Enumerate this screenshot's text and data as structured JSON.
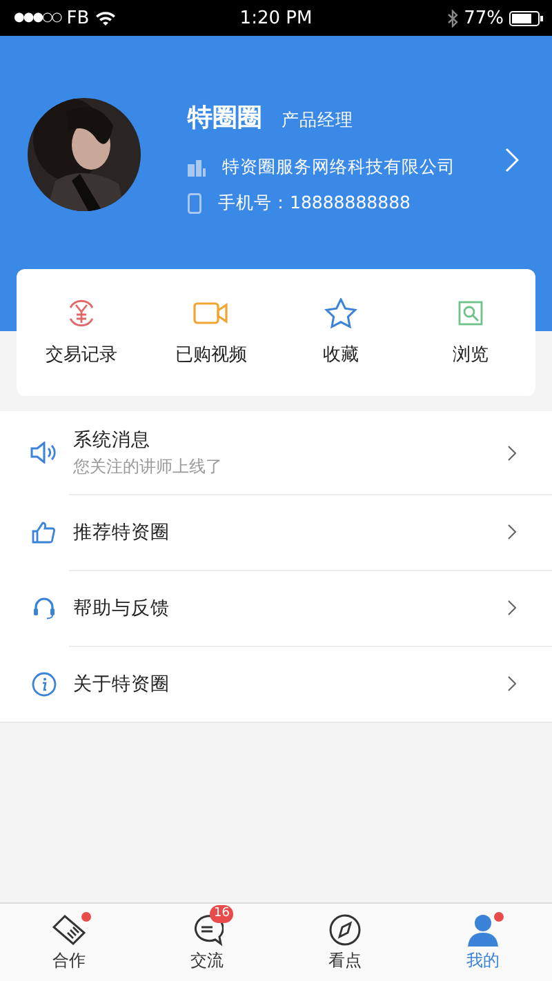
{
  "status_bar": {
    "signal": "●●●○○",
    "carrier": "FB",
    "time": "1:20 PM",
    "battery": "77%"
  },
  "profile": {
    "name": "特圈圈",
    "title": "产品经理",
    "company": "特资圈服务网络科技有限公司",
    "phone": "手机号：18888888888"
  },
  "shortcuts": [
    {
      "kind": "transactions",
      "label": "交易记录"
    },
    {
      "kind": "video",
      "label": "已购视频"
    },
    {
      "kind": "favorites",
      "label": "收藏"
    },
    {
      "kind": "browse",
      "label": "浏览"
    }
  ],
  "menu": [
    {
      "kind": "messages",
      "title": "系统消息",
      "subtitle": "您关注的讲师上线了"
    },
    {
      "kind": "recommend",
      "title": "推荐特资圈"
    },
    {
      "kind": "help",
      "title": "帮助与反馈"
    },
    {
      "kind": "about",
      "title": "关于特资圈"
    }
  ],
  "tabs": [
    {
      "kind": "cooperate",
      "label": "合作",
      "selected": false,
      "dot": true
    },
    {
      "kind": "chat",
      "label": "交流",
      "selected": false,
      "dot": false,
      "badge": "16"
    },
    {
      "kind": "discover",
      "label": "看点",
      "selected": false,
      "dot": false
    },
    {
      "kind": "me",
      "label": "我的",
      "selected": true,
      "dot": true
    }
  ]
}
